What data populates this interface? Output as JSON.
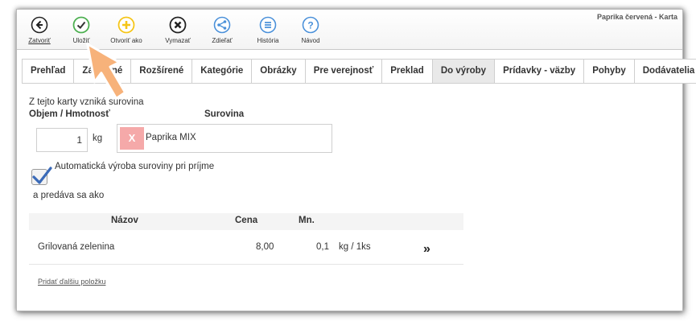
{
  "window": {
    "title": "Paprika červená - Karta"
  },
  "toolbar": {
    "close_label": "Zatvoriť",
    "save_label": "Uložiť",
    "open_as_label": "Otvoriť ako",
    "delete_label": "Vymazať",
    "share_label": "Zdieľať",
    "history_label": "História",
    "help_label": "Návod"
  },
  "tabs": [
    {
      "label": "Prehľad"
    },
    {
      "label": "Základné"
    },
    {
      "label": "Rozšírené"
    },
    {
      "label": "Kategórie"
    },
    {
      "label": "Obrázky"
    },
    {
      "label": "Pre verejnosť"
    },
    {
      "label": "Preklad"
    },
    {
      "label": "Do výroby",
      "active": true
    },
    {
      "label": "Prídavky - väzby"
    },
    {
      "label": "Pohyby"
    },
    {
      "label": "Dodávatelia"
    }
  ],
  "production": {
    "intro": "Z tejto karty vzniká surovina",
    "volume_header": "Objem / Hmotnosť",
    "material_header": "Surovina",
    "quantity_value": "1",
    "unit": "kg",
    "material_name": "Paprika MIX",
    "remove_glyph": "X",
    "auto_production_label": "Automatická výroba suroviny pri príjme",
    "auto_production_checked": true,
    "sold_as_label": "a predáva sa ako"
  },
  "table": {
    "headers": {
      "name": "Názov",
      "price": "Cena",
      "qty": "Mn."
    },
    "rows": [
      {
        "name": "Grilovaná zelenina",
        "price": "8,00",
        "qty": "0,1",
        "unit": "kg / 1ks",
        "action": "»"
      }
    ]
  },
  "add_item_link": "Pridať ďalšiu položku",
  "colors": {
    "save_green": "#4caf50",
    "open_yellow": "#f5c518",
    "share_blue": "#4a90d9",
    "delete_dark": "#222222",
    "remove_red": "#f5a9a9",
    "active_tab": "#e9e9e9",
    "pointer_arrow": "#f7b27a"
  }
}
